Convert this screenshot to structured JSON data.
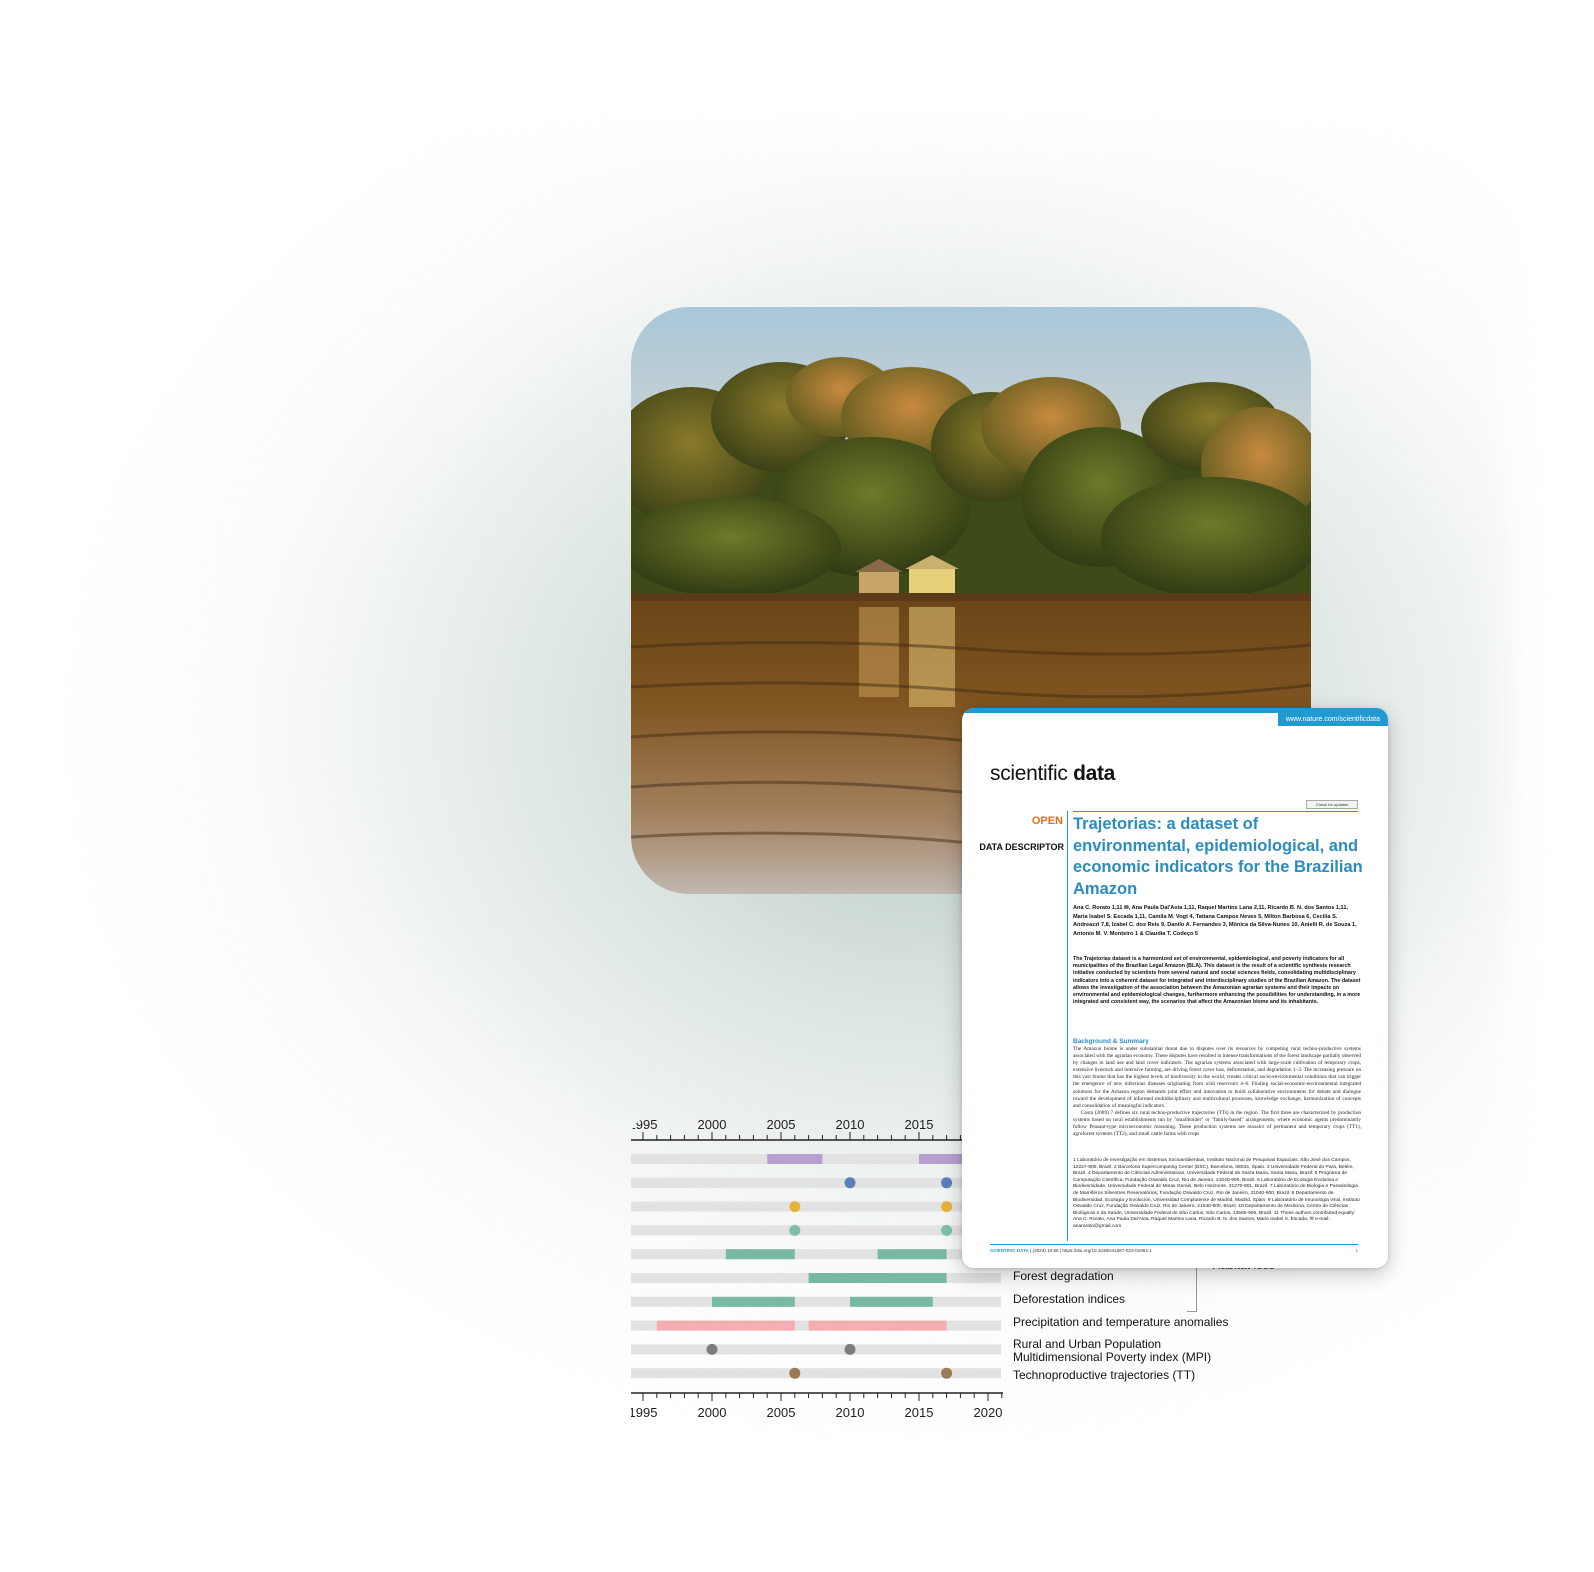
{
  "paper": {
    "url": "www.nature.com/scientificdata",
    "journal_light": "scientific",
    "journal_bold": "data",
    "check_updates": "Check for updates",
    "open_label": "OPEN",
    "descriptor_label": "DATA DESCRIPTOR",
    "title": "Trajetorias: a dataset of environmental, epidemiological, and economic indicators for the Brazilian Amazon",
    "authors": "Ana C. Rorato 1,11 ✉, Ana Paula Dal'Asta 1,11, Raquel Martins Lana 2,11, Ricardo B. N. dos Santos 1,11, Maria Isabel S. Escada 1,11, Camila M. Vogt 4, Tatiana Campos Neves 5, Milton Barbosa 6, Cecilia S. Andreazzi 7,8, Izabel C. dos Reis 9, Danilo A. Fernandes 3, Mônica da Silva-Nunes 10, Anielli R. de Souza 1, Antonio M. V. Monteiro 1 & Claudia T. Codeço 5",
    "abstract": "The Trajetorias dataset is a harmonized set of environmental, epidemiological, and poverty indicators for all municipalities of the Brazilian Legal Amazon (BLA). This dataset is the result of a scientific synthesis research initiative conducted by scientists from several natural and social sciences fields, consolidating multidisciplinary indicators into a coherent dataset for integrated and interdisciplinary studies of the Brazilian Amazon. The dataset allows the investigation of the association between the Amazonian agrarian systems and their impacts on environmental and epidemiological changes, furthermore enhancing the possibilities for understanding, in a more integrated and consistent way, the scenarios that affect the Amazonian biome and its inhabitants.",
    "background_heading": "Background & Summary",
    "body_paragraph_1": "The Amazon biome is under substantial threat due to disputes over its resources by competing rural techno-productive systems associated with the agrarian economy. These disputes have resulted in intense transformations of the forest landscape partially observed by changes in land use and land cover indicators. The agrarian systems associated with large-scale cultivation of temporary crops, extensive livestock and intensive farming, are driving forest cover loss, deforestation, and degradation 1–3. The increasing pressure on this vast biome that has the highest levels of biodiversity in the world, creates critical socio-environmental conditions that can trigger the emergence of new infectious diseases originating from wild reservoirs 4–6. Finding social-economic-environmental integrated solutions for the Amazon region demands joint effort and innovation to build collaborative environments for debate and dialogue toward the development of informed multidisciplinary and multicultural processes, knowledge exchange, harmonization of concepts and consolidation of meaningful indicators.",
    "body_paragraph_2": "Costa (2009) 7 defines six rural techno-productive trajectories (TTs) in the region. The first three are characterized by production systems based on rural establishments run by \"smallholder\" or \"family-based\" arrangements, where economic agents predominantly follow Peasant-type microeconomic reasoning. These production systems are mosaics of permanent and temporary crops (TT1), agroforest systems (TT2), and small cattle farms with crops",
    "affiliations": "1 Laboratório de Investigação em Sistemas Socioambientais, Instituto Nacional de Pesquisas Espaciais, São José dos Campos, 12227-900, Brazil. 2 Barcelona Supercomputing Center (BSC), Barcelona, 08034, Spain. 3 Universidade Federal do Pará, Belém, Brazil. 4 Departamento de Ciências Administrativas, Universidade Federal de Santa Maria, Santa Maria, Brazil. 5 Programa de Computação Científica, Fundação Oswaldo Cruz, Rio de Janeiro, 21040-900, Brazil. 6 Laboratório de Ecologia Evolutiva e Biodiversidade, Universidade Federal de Minas Gerais, Belo Horizonte, 31270-901, Brazil. 7 Laboratório de Biologia e Parasitologia de Mamíferos Silvestres Reservatórios, Fundação Oswaldo Cruz, Rio de Janeiro, 21040-900, Brazil. 8 Departamento de Biodiversidad, Ecología y Evolución, Universidad Complutense de Madrid, Madrid, Spain. 9 Laboratório de Imunologia Viral, Instituto Oswaldo Cruz, Fundação Oswaldo Cruz, Rio de Janeiro, 21040-900, Brazil. 10 Departamento de Medicina, Centro de Ciências Biológicas e da Saúde, Universidade Federal de São Carlos, São Carlos, 13565-905, Brazil. 11 These authors contributed equally: Ana C. Rorato, Ana Paula Dal'Asta, Raquel Martins Lana, Ricardo B. N. dos Santos, Maria Isabel S. Escada. ✉ e-mail: anarorato@gmail.com",
    "footer_journal": "SCIENTIFIC DATA |",
    "footer_ref": "(2023) 10:65 | https://doi.org/10.1038/s41597-023-01962-1",
    "footer_page": "1"
  },
  "timeline": {
    "top_ticks": [
      "1995",
      "2000",
      "2005",
      "2010",
      "2015"
    ],
    "bottom_ticks": [
      "1995",
      "2000",
      "2005",
      "2010",
      "2015",
      "2020"
    ],
    "rows": [
      {
        "kind": "bars",
        "color": "#b79fd0",
        "spans": [
          [
            2004,
            2008
          ],
          [
            2015,
            2019
          ]
        ]
      },
      {
        "kind": "dots",
        "color": "#5d7fb8",
        "points": [
          2010,
          2017
        ]
      },
      {
        "kind": "dots",
        "color": "#e6b43c",
        "points": [
          2006,
          2017
        ]
      },
      {
        "kind": "dots",
        "color": "#7fbfa9",
        "points": [
          2006,
          2017
        ]
      },
      {
        "kind": "bars",
        "color": "#79b8a2",
        "spans": [
          [
            2001,
            2006
          ],
          [
            2012,
            2017
          ]
        ]
      },
      {
        "kind": "bars",
        "color": "#79b8a2",
        "spans": [
          [
            2007,
            2017
          ]
        ]
      },
      {
        "kind": "bars",
        "color": "#79b8a2",
        "spans": [
          [
            2000,
            2006
          ],
          [
            2010,
            2016
          ]
        ]
      },
      {
        "kind": "bars",
        "color": "#f4aeb3",
        "spans": [
          [
            1996,
            2006
          ],
          [
            2007,
            2017
          ]
        ]
      },
      {
        "kind": "dots",
        "color": "#7d7d7d",
        "points": [
          2000,
          2010
        ]
      },
      {
        "kind": "dots",
        "color": "#9a7a55",
        "points": [
          2006,
          2017
        ]
      }
    ]
  },
  "row_labels": {
    "habitat_loss": "Habitat loss",
    "forest_degradation": "Forest degradation",
    "deforestation": "Deforestation indices",
    "precipitation": "Precipitation and temperature anomalies",
    "population_line1": "Rural and Urban Population",
    "population_line2": "Multidimensional Poverty index (MPI)",
    "technoproductive": "Technoproductive trajectories (TT)"
  }
}
